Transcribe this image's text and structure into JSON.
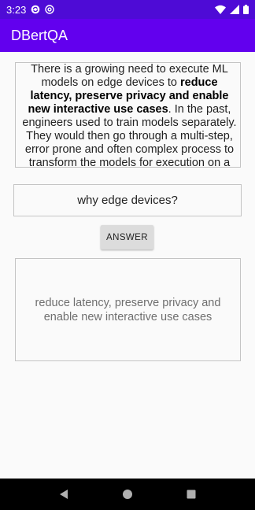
{
  "status_bar": {
    "time": "3:23"
  },
  "app": {
    "title": "DBertQA"
  },
  "passage": {
    "segments": [
      {
        "text": "There is a growing need to execute ML models on edge devices to ",
        "bold": false
      },
      {
        "text": "reduce latency, preserve privacy and enable new interactive use cases",
        "bold": true
      },
      {
        "text": ". In the past, engineers used to train models separately. They would then go through a multi-step, error prone and often complex process to transform the models for execution on a",
        "bold": false
      }
    ]
  },
  "question": {
    "value": "why edge devices?"
  },
  "answer_button": {
    "label": "ANSWER"
  },
  "answer": {
    "text": "reduce latency, preserve privacy and enable new interactive use cases"
  },
  "colors": {
    "status_bar": "#4e0bd6",
    "app_bar": "#6200ee",
    "background": "#fafafa",
    "nav_bar": "#000000"
  },
  "icons": {
    "status_left": [
      "sync-icon",
      "at-sign-icon"
    ],
    "status_right": [
      "wifi-icon",
      "signal-icon",
      "battery-icon"
    ],
    "nav": [
      "back-icon",
      "home-icon",
      "recents-icon"
    ]
  }
}
